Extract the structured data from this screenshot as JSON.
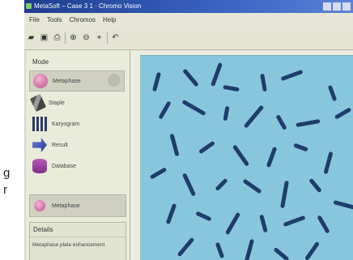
{
  "background_text": {
    "line1": "g",
    "line2": "r"
  },
  "window": {
    "title": "MetaSoft – Case 3 1 · Chromo Vision",
    "controls": [
      "minimize",
      "maximize",
      "close"
    ]
  },
  "menu": [
    "File",
    "Tools",
    "Chromos",
    "Help"
  ],
  "toolbar": {
    "icons": [
      "open-icon",
      "save-icon",
      "print-icon",
      "zoom-in-icon",
      "zoom-out-icon",
      "measure-icon",
      "arrow-icon"
    ]
  },
  "sidebar": {
    "mode_header": "Mode",
    "modes": [
      {
        "label": "Metaphase",
        "icon": "metaphase-icon"
      },
      {
        "label": "Staple",
        "icon": "staple-icon"
      },
      {
        "label": "Karyogram",
        "icon": "karyogram-icon"
      },
      {
        "label": "Result",
        "icon": "result-icon"
      },
      {
        "label": "Database",
        "icon": "database-icon"
      }
    ],
    "bottom_item": "Metaphase",
    "details_header": "Details",
    "details_text": "Metaphase plate enhancement"
  },
  "colors": {
    "titlebar": "#2b4fa8",
    "image_bg": "#88c6dc",
    "chromosome": "#1f3d6b",
    "sidebar_bg": "#e9ecd8"
  }
}
